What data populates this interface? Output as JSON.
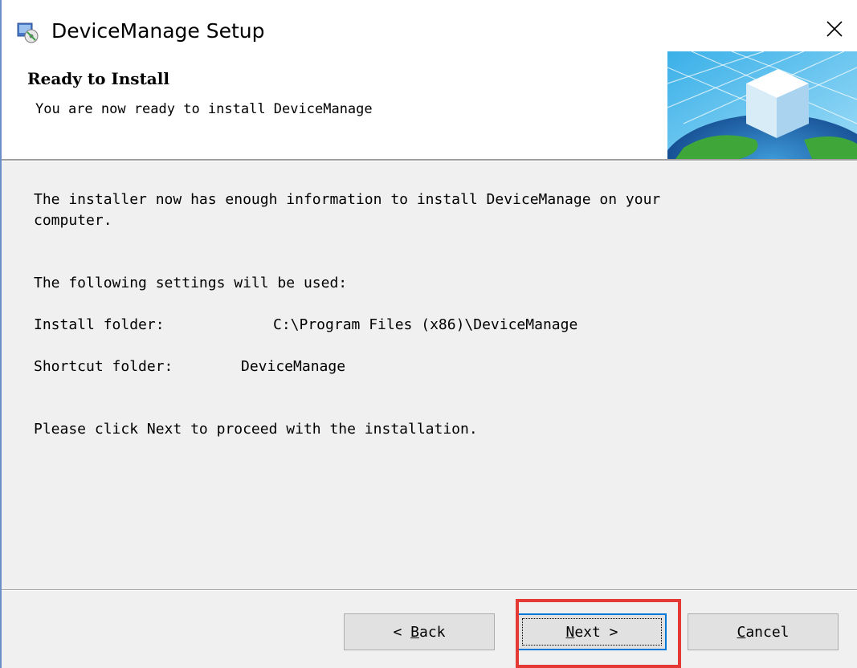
{
  "window": {
    "title": "DeviceManage Setup"
  },
  "header": {
    "title": "Ready to Install",
    "subtitle": "You are now ready to install DeviceManage"
  },
  "body": {
    "intro_line1": "The installer now has enough information to install DeviceManage on your",
    "intro_line2": "computer.",
    "settings_heading": "The following settings will be used:",
    "install_folder_label": "Install folder:",
    "install_folder_value": "C:\\Program Files (x86)\\DeviceManage",
    "shortcut_folder_label": "Shortcut folder:",
    "shortcut_folder_value": "DeviceManage",
    "instruction": "Please click Next to proceed with the installation."
  },
  "buttons": {
    "back": {
      "prefix": "< ",
      "mnemonic": "B",
      "rest": "ack"
    },
    "next": {
      "prefix": "",
      "mnemonic": "N",
      "rest": "ext >"
    },
    "cancel": {
      "prefix": "",
      "mnemonic": "C",
      "rest": "ancel"
    }
  },
  "colors": {
    "highlight": "#e53935",
    "focus_border": "#0078d7"
  }
}
